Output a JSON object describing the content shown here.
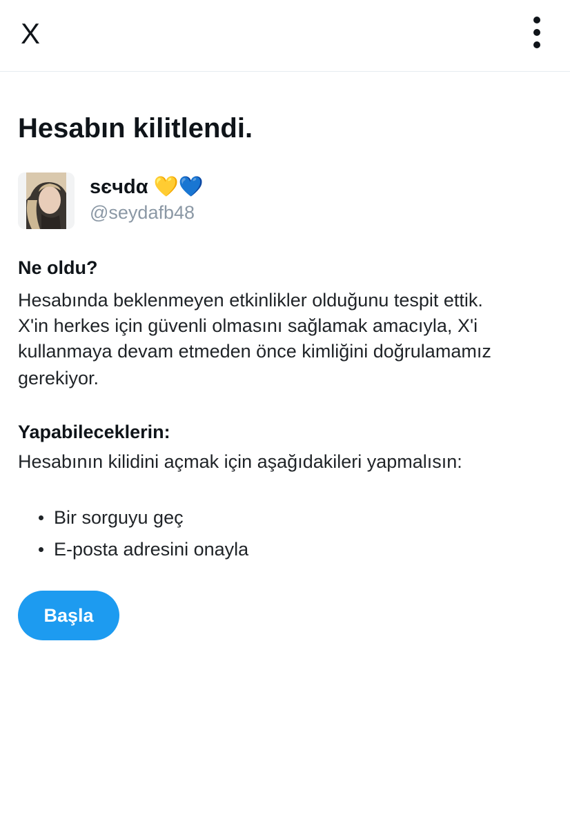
{
  "header": {
    "close_label": "X",
    "more_icon": "more-vertical-icon"
  },
  "title": "Hesabın kilitlendi.",
  "account": {
    "display_name": "sєчdα 💛💙",
    "handle": "@seydafb48"
  },
  "what_happened": {
    "heading": "Ne oldu?",
    "lines": [
      "Hesabında beklenmeyen etkinlikler olduğunu tespit ettik.",
      "X'in herkes için güvenli olmasını sağlamak amacıyla, X'i",
      "kullanmaya devam etmeden önce kimliğini doğrulamamız",
      "gerekiyor."
    ]
  },
  "what_you_can_do": {
    "heading": "Yapabileceklerin:",
    "text": "Hesabının kilidini açmak için aşağıdakileri yapmalısın:",
    "items": [
      "Bir sorguyu geç",
      "E-posta adresini onayla"
    ]
  },
  "start_button": {
    "label": "Başla",
    "color": "#1d9bf0"
  }
}
